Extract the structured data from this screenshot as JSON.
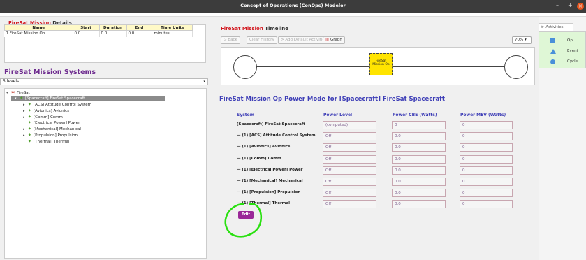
{
  "window": {
    "title": "Concept of Operations (ConOps) Modeler",
    "minimize": "–",
    "maximize": "+",
    "close": "×"
  },
  "details": {
    "title_red": "FireSat Mission",
    "title_rest": " Details",
    "headers": [
      "Name",
      "Start",
      "Duration",
      "End",
      "Time Units"
    ],
    "row_index": "1",
    "row": [
      "FireSat Mission Op",
      "0.0",
      "0.0",
      "0.0",
      "minutes"
    ]
  },
  "systems": {
    "title": "FireSat Mission Systems",
    "levels_value": "5 levels",
    "tree": [
      {
        "label": "FireSat",
        "twisty": "▾",
        "icon": "✲",
        "indent": 0
      },
      {
        "label": "[Spacecraft] FireSat Spacecraft",
        "twisty": "▾",
        "icon": "✦",
        "indent": 1
      },
      {
        "label": "[ACS] Attitude Control System",
        "twisty": "▸",
        "icon": "✦",
        "indent": 2
      },
      {
        "label": "[Avionics] Avionics",
        "twisty": "▸",
        "icon": "✦",
        "indent": 2
      },
      {
        "label": "[Comm] Comm",
        "twisty": "▸",
        "icon": "✦",
        "indent": 2
      },
      {
        "label": "[Electrical Power] Power",
        "twisty": "",
        "icon": "✦",
        "indent": 2
      },
      {
        "label": "[Mechanical] Mechanical",
        "twisty": "▸",
        "icon": "✦",
        "indent": 2
      },
      {
        "label": "[Propulsion] Propulsion",
        "twisty": "▸",
        "icon": "✦",
        "indent": 2
      },
      {
        "label": "[Thermal] Thermal",
        "twisty": "",
        "icon": "✦",
        "indent": 2
      }
    ]
  },
  "timeline": {
    "title_red": "FireSat Mission",
    "title_rest": " Timeline",
    "back": "Back",
    "clear_history": "Clear History",
    "add_default": "Add Default Activities",
    "graph": "Graph",
    "zoom": "70%",
    "activity_label": "FireSat Mission Op"
  },
  "power": {
    "title": "FireSat Mission Op Power Mode for [Spacecraft] FireSat Spacecraft",
    "col_system": "System",
    "col_level": "Power Level",
    "col_cbe": "Power CBE (Watts)",
    "col_mev": "Power MEV (Watts)",
    "rows": [
      {
        "system": "[Spacecraft] FireSat Spacecraft",
        "level": "(computed)",
        "cbe": "0",
        "mev": "0"
      },
      {
        "system": "— (1) [ACS] Attitude Control System",
        "level": "Off",
        "cbe": "0.0",
        "mev": "0"
      },
      {
        "system": "— (1) [Avionics] Avionics",
        "level": "Off",
        "cbe": "0.0",
        "mev": "0"
      },
      {
        "system": "— (1) [Comm] Comm",
        "level": "Off",
        "cbe": "0.0",
        "mev": "0"
      },
      {
        "system": "— (1) [Electrical Power] Power",
        "level": "Off",
        "cbe": "0.0",
        "mev": "0"
      },
      {
        "system": "— (1) [Mechanical] Mechanical",
        "level": "Off",
        "cbe": "0.0",
        "mev": "0"
      },
      {
        "system": "— (1) [Propulsion] Propulsion",
        "level": "Off",
        "cbe": "0.0",
        "mev": "0"
      },
      {
        "system": "— (1) [Thermal] Thermal",
        "level": "Off",
        "cbe": "0.0",
        "mev": "0"
      }
    ],
    "edit": "Edit"
  },
  "activities": {
    "tab": "Activities",
    "items": [
      {
        "label": "Op",
        "shape": "square-icon"
      },
      {
        "label": "Event",
        "shape": "triangle-icon"
      },
      {
        "label": "Cycle",
        "shape": "circle-icon"
      }
    ]
  },
  "colors": {
    "accent_red": "#d2171e",
    "purple": "#6e2c8f",
    "blue": "#3d3db6",
    "activity_yellow": "#ffe400",
    "edit_purple": "#9a2898",
    "annotation_green": "#29e010"
  }
}
